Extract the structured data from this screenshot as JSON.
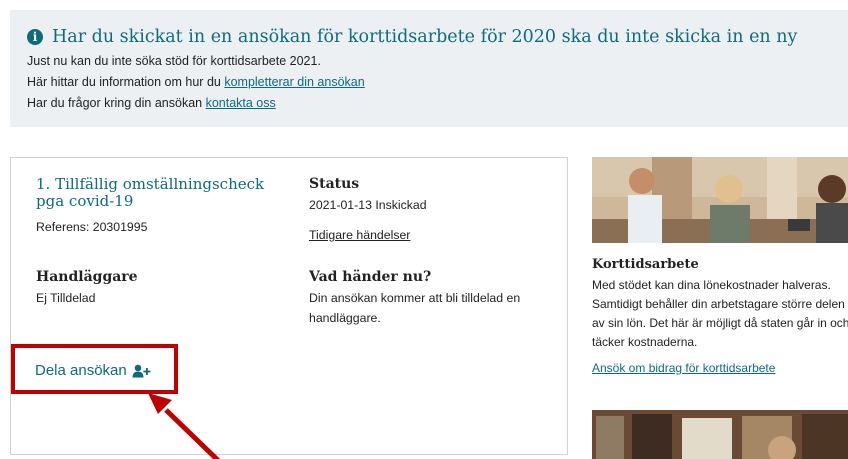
{
  "notice": {
    "headline": "Har du skickat in en ansökan för korttidsarbete för 2020 ska du inte skicka in en ny",
    "line1": "Just nu kan du inte söka stöd för korttidsarbete 2021.",
    "line2_prefix": "Här hittar du information om hur du ",
    "line2_link": "kompletterar din ansökan",
    "line3_prefix": "Har du frågor kring din ansökan ",
    "line3_link": "kontakta oss"
  },
  "application": {
    "title": "1. Tillfällig omställningscheck pga covid-19",
    "reference": "Referens: 20301995",
    "status_heading": "Status",
    "status_value": "2021-01-13 Inskickad",
    "history_link": "Tidigare händelser",
    "officer_heading": "Handläggare",
    "officer_value": "Ej Tilldelad",
    "next_heading": "Vad händer nu?",
    "next_text": "Din ansökan kommer att bli tilldelad en handläggare.",
    "share_label": "Dela ansökan"
  },
  "sidebar": {
    "title": "Korttidsarbete",
    "text": "Med stödet kan dina lönekostnader halveras. Samtidigt behåller din arbetstagare större delen av sin lön. Det här är möjligt då staten går in och täcker kostnaderna.",
    "link": "Ansök om bidrag för korttidsarbete"
  },
  "colors": {
    "accent": "#0d6b7e",
    "highlight": "#c00000",
    "banner_bg": "#edf0f3"
  }
}
